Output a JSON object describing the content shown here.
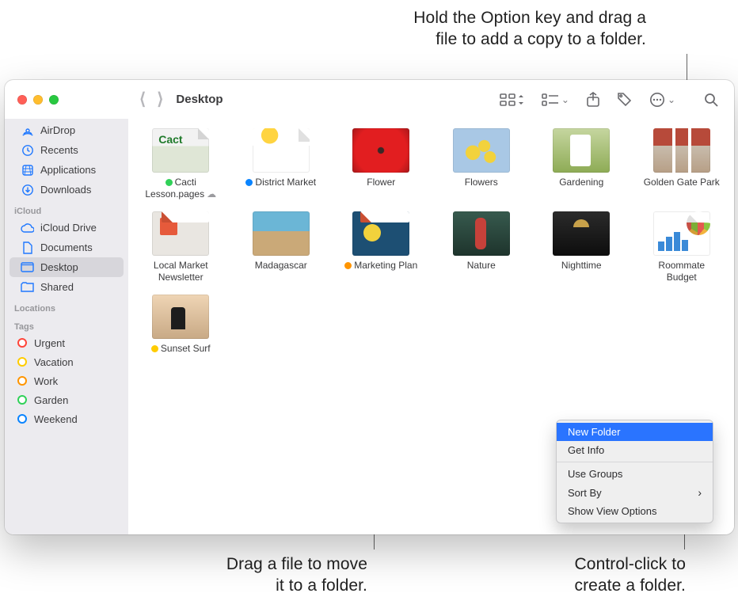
{
  "callouts": {
    "top_line1": "Hold the Option key and drag a",
    "top_line2": "file to add a copy to a folder.",
    "bottom_left_line1": "Drag a file to move",
    "bottom_left_line2": "it to a folder.",
    "bottom_right_line1": "Control-click to",
    "bottom_right_line2": "create a folder."
  },
  "window": {
    "title": "Desktop",
    "toolbar_icons": {
      "view_grid": "icon-view",
      "group": "group",
      "share": "share",
      "tag": "tag",
      "more": "more",
      "search": "search"
    }
  },
  "sidebar": {
    "favorites": [
      {
        "key": "airdrop",
        "label": "AirDrop"
      },
      {
        "key": "recents",
        "label": "Recents"
      },
      {
        "key": "applications",
        "label": "Applications"
      },
      {
        "key": "downloads",
        "label": "Downloads"
      }
    ],
    "icloud_label": "iCloud",
    "icloud": [
      {
        "key": "icloud-drive",
        "label": "iCloud Drive"
      },
      {
        "key": "documents",
        "label": "Documents"
      },
      {
        "key": "desktop",
        "label": "Desktop",
        "active": true
      },
      {
        "key": "shared",
        "label": "Shared"
      }
    ],
    "locations_label": "Locations",
    "tags_label": "Tags",
    "tags": [
      {
        "label": "Urgent",
        "color": "#ff453a"
      },
      {
        "label": "Vacation",
        "color": "#ffcc00"
      },
      {
        "label": "Work",
        "color": "#ff9500"
      },
      {
        "label": "Garden",
        "color": "#30d158"
      },
      {
        "label": "Weekend",
        "color": "#0a84ff"
      }
    ]
  },
  "files": [
    {
      "name_line1": "Cacti",
      "name_line2": "Lesson.pages",
      "tag": "#30d158",
      "cloud": true,
      "art": "art-cacti",
      "dogear": true
    },
    {
      "name_line1": "District Market",
      "name_line2": "",
      "tag": "#0a84ff",
      "cloud": false,
      "art": "art-district",
      "dogear": true
    },
    {
      "name_line1": "Flower",
      "name_line2": "",
      "tag": "",
      "cloud": false,
      "art": "art-flower"
    },
    {
      "name_line1": "Flowers",
      "name_line2": "",
      "tag": "",
      "cloud": false,
      "art": "art-flowers"
    },
    {
      "name_line1": "Gardening",
      "name_line2": "",
      "tag": "",
      "cloud": false,
      "art": "art-garden"
    },
    {
      "name_line1": "Golden Gate Park",
      "name_line2": "",
      "tag": "",
      "cloud": false,
      "art": "art-ggp"
    },
    {
      "name_line1": "Local Market",
      "name_line2": "Newsletter",
      "tag": "",
      "cloud": false,
      "art": "art-local",
      "dogear": true
    },
    {
      "name_line1": "Madagascar",
      "name_line2": "",
      "tag": "",
      "cloud": false,
      "art": "art-madag"
    },
    {
      "name_line1": "Marketing Plan",
      "name_line2": "",
      "tag": "#ff9500",
      "cloud": false,
      "art": "art-market",
      "dogear": true
    },
    {
      "name_line1": "Nature",
      "name_line2": "",
      "tag": "",
      "cloud": false,
      "art": "art-nature"
    },
    {
      "name_line1": "Nighttime",
      "name_line2": "",
      "tag": "",
      "cloud": false,
      "art": "art-night"
    },
    {
      "name_line1": "Roommate",
      "name_line2": "Budget",
      "tag": "",
      "cloud": false,
      "art": "art-budget",
      "dogear": true
    },
    {
      "name_line1": "Sunset Surf",
      "name_line2": "",
      "tag": "#ffcc00",
      "cloud": false,
      "art": "art-sunset"
    }
  ],
  "context_menu": {
    "items": [
      {
        "label": "New Folder",
        "selected": true
      },
      {
        "label": "Get Info"
      },
      {
        "separator": true
      },
      {
        "label": "Use Groups"
      },
      {
        "label": "Sort By",
        "submenu": true
      },
      {
        "label": "Show View Options"
      }
    ]
  }
}
